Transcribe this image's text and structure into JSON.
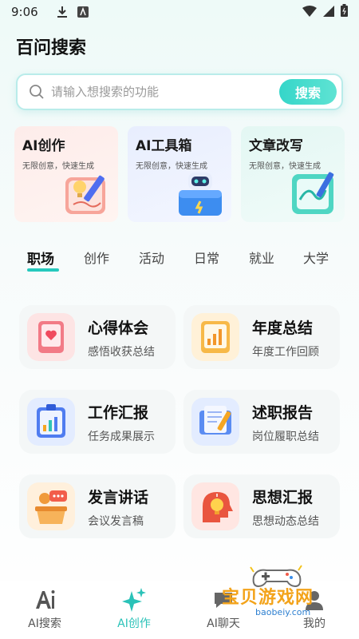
{
  "status_bar": {
    "time": "9:06"
  },
  "header": {
    "title": "百问搜索"
  },
  "search": {
    "placeholder": "请输入想搜索的功能",
    "button_label": "搜索"
  },
  "feature_cards": [
    {
      "title": "AI创作",
      "subtitle": "无限创意，快速生成"
    },
    {
      "title": "AI工具箱",
      "subtitle": "无限创意，快速生成"
    },
    {
      "title": "文章改写",
      "subtitle": "无限创意，快速生成"
    }
  ],
  "tabs": [
    "职场",
    "创作",
    "活动",
    "日常",
    "就业",
    "大学"
  ],
  "active_tab": "职场",
  "grid": [
    {
      "title": "心得体会",
      "subtitle": "感悟收获总结"
    },
    {
      "title": "年度总结",
      "subtitle": "年度工作回顾"
    },
    {
      "title": "工作汇报",
      "subtitle": "任务成果展示"
    },
    {
      "title": "述职报告",
      "subtitle": "岗位履职总结"
    },
    {
      "title": "发言讲话",
      "subtitle": "会议发言稿"
    },
    {
      "title": "思想汇报",
      "subtitle": "思想动态总结"
    }
  ],
  "bottom_nav": [
    {
      "label": "AI搜索",
      "icon": "ai-search-icon"
    },
    {
      "label": "AI创作",
      "icon": "sparkle-icon",
      "active": true
    },
    {
      "label": "AI聊天",
      "icon": "chat-icon"
    },
    {
      "label": "我的",
      "icon": "profile-icon"
    }
  ],
  "watermark": {
    "text": "宝贝游戏网",
    "url": "baobeiy.com"
  },
  "colors": {
    "accent": "#26c9bd",
    "search_border": "#b9ecea"
  }
}
